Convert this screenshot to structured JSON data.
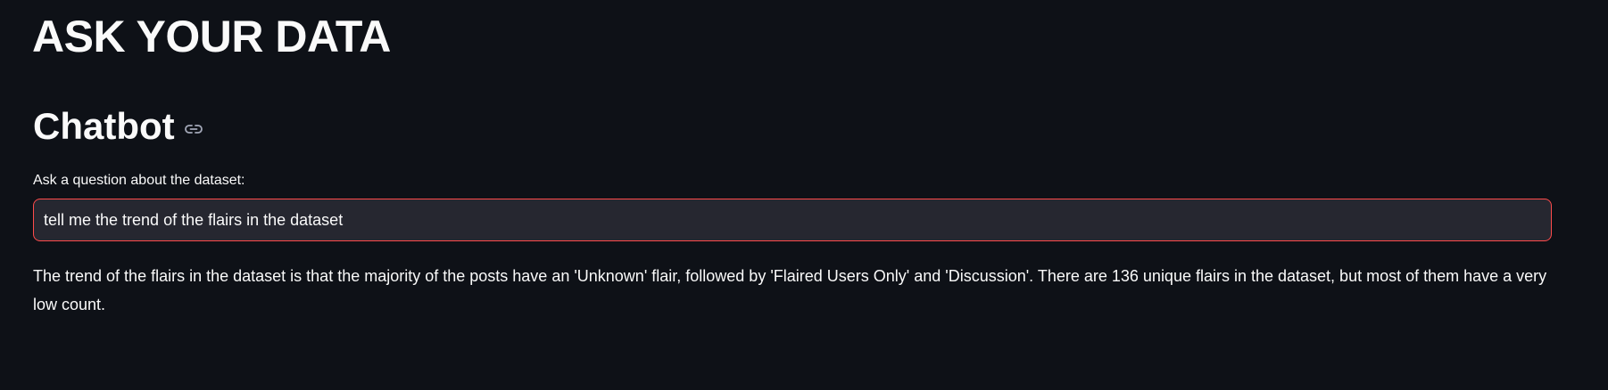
{
  "header": {
    "title": "ASK YOUR DATA"
  },
  "chatbot": {
    "heading": "Chatbot",
    "anchor_icon": "link-icon",
    "question_label": "Ask a question about the dataset:",
    "question_value": "tell me the trend of the flairs in the dataset",
    "answer": "The trend of the flairs in the dataset is that the majority of the posts have an 'Unknown' flair, followed by 'Flaired Users Only' and 'Discussion'. There are 136 unique flairs in the dataset, but most of them have a very low count."
  },
  "colors": {
    "background": "#0e1117",
    "text": "#fafafa",
    "input_background": "#262730",
    "focus_border": "#ff4b4b",
    "icon": "#a3a8b8"
  }
}
